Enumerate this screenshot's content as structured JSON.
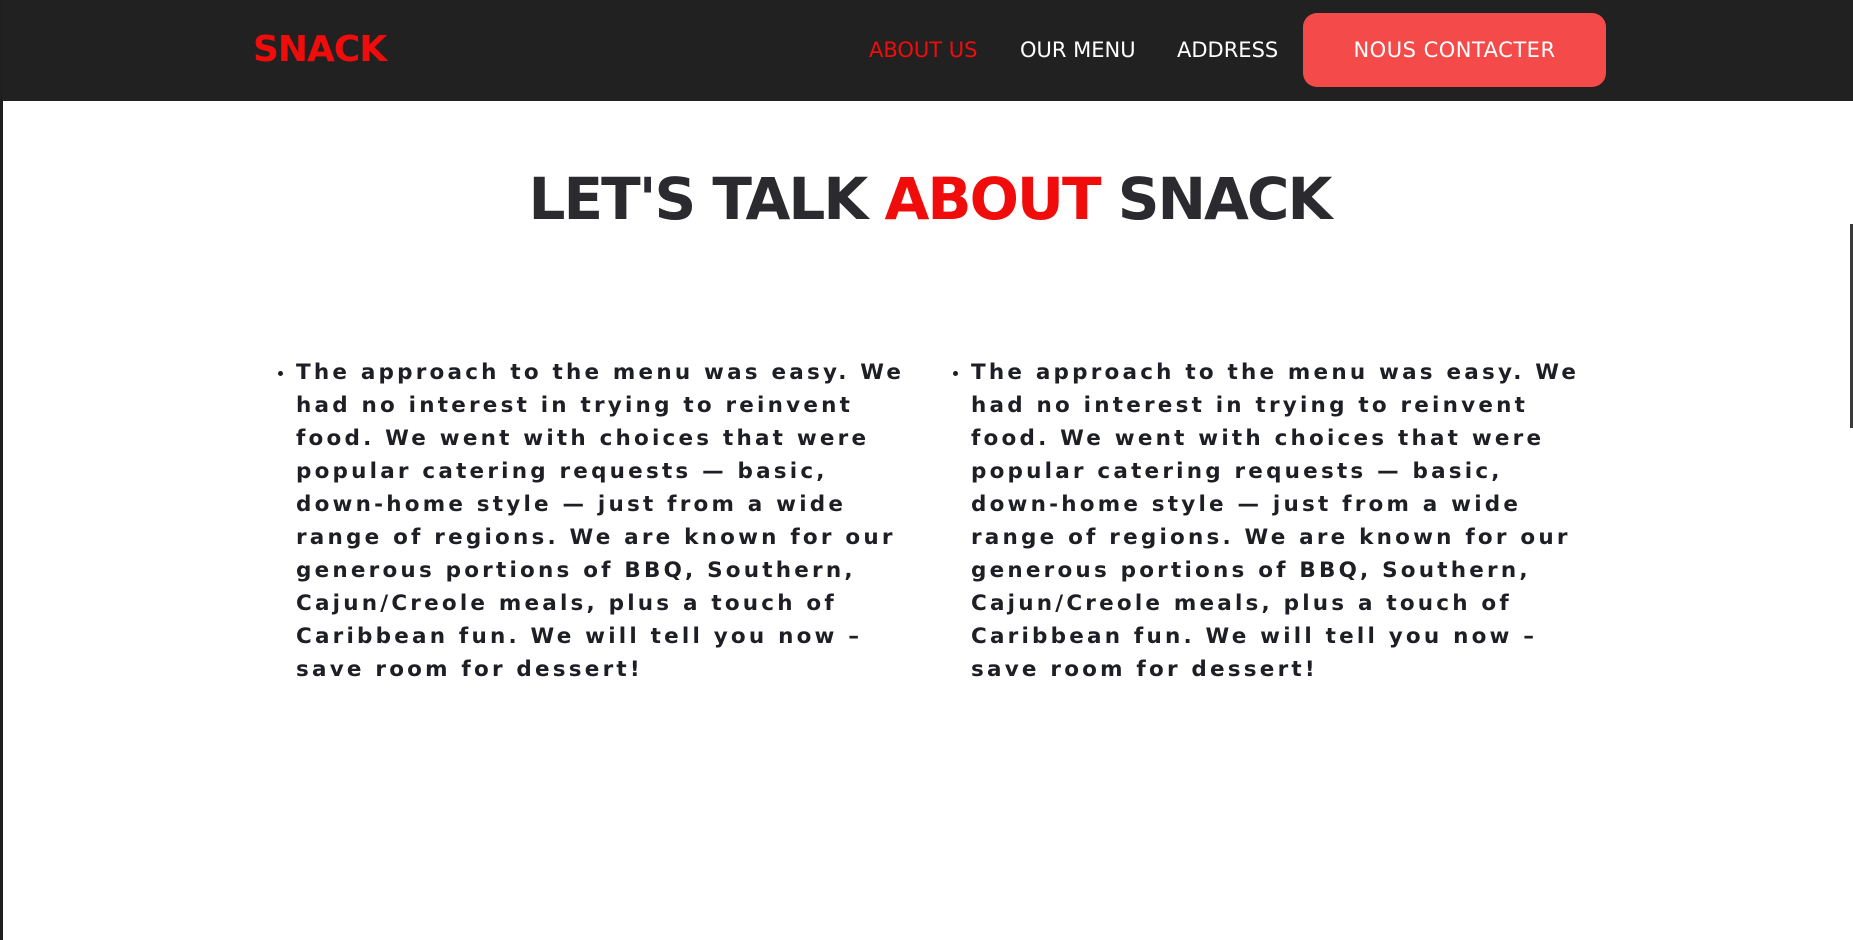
{
  "header": {
    "logo": "SNACK",
    "nav": [
      {
        "label": "ABOUT US",
        "active": true
      },
      {
        "label": "OUR MENU",
        "active": false
      },
      {
        "label": "ADDRESS",
        "active": false
      }
    ],
    "contact_button": "NOUS CONTACTER"
  },
  "section": {
    "heading_prefix": "LET'S TALK",
    "heading_accent": "ABOUT",
    "heading_suffix": "SNACK",
    "columns": [
      {
        "text": "The approach to the menu was easy. We had no interest in trying to reinvent food. We went with choices that were popular catering requests — basic, down-home style — just from a wide range of regions. We are known for our generous portions of BBQ, Southern, Cajun/Creole meals, plus a touch of Caribbean fun. We will tell you now – save room for dessert!"
      },
      {
        "text": "The approach to the menu was easy. We had no interest in trying to reinvent food. We went with choices that were popular catering requests — basic, down-home style — just from a wide range of regions. We are known for our generous portions of BBQ, Southern, Cajun/Creole meals, plus a touch of Caribbean fun. We will tell you now – save room for dessert!"
      }
    ]
  },
  "colors": {
    "accent": "#f10c0c",
    "header_bg": "#212121",
    "button_bg": "#f54a4a",
    "text_dark": "#2b2b2f"
  }
}
